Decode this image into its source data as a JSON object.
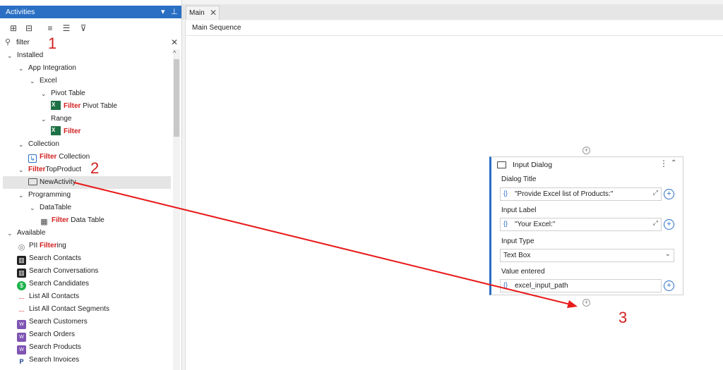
{
  "panel": {
    "title": "Activities",
    "search_value": "filter",
    "colors": {
      "header": "#2a6fc4",
      "highlight": "#d11f1f"
    }
  },
  "tree": {
    "installed": "Installed",
    "app_integration": "App Integration",
    "excel": "Excel",
    "pivot_table": "Pivot Table",
    "filter_pivot_table": {
      "hl": "Filter",
      "rest": " Pivot Table"
    },
    "range": "Range",
    "filter_range": {
      "hl": "Filter",
      "rest": ""
    },
    "collection": "Collection",
    "filter_collection": {
      "hl": "Filter",
      "rest": " Collection"
    },
    "filtertopproduct": {
      "hl": "Filter",
      "rest": "TopProduct"
    },
    "newactivity": "NewActivity",
    "programming": "Programming",
    "datatable": "DataTable",
    "filter_data_table": {
      "hl": "Filter",
      "rest": " Data Table"
    },
    "available": "Available",
    "pii": {
      "pre": "PII ",
      "hl": "Filter",
      "post": "ing"
    },
    "available_items": [
      "Search Contacts",
      "Search Conversations",
      "Search Candidates",
      "List All Contacts",
      "List All Contact Segments",
      "Search Customers",
      "Search Orders",
      "Search Products",
      "Search Invoices"
    ]
  },
  "tabs": {
    "main": "Main"
  },
  "designer": {
    "breadcrumb": "Main Sequence",
    "card": {
      "title": "Input Dialog",
      "dialog_title_label": "Dialog Title",
      "dialog_title_value": "\"Provide Excel list of Products:\"",
      "input_label_label": "Input Label",
      "input_label_value": "\"Your Excel:\"",
      "input_type_label": "Input Type",
      "input_type_value": "Text Box",
      "value_entered_label": "Value entered",
      "value_entered_value": "excel_input_path"
    }
  },
  "annotations": {
    "one": "1",
    "two": "2",
    "three": "3"
  }
}
